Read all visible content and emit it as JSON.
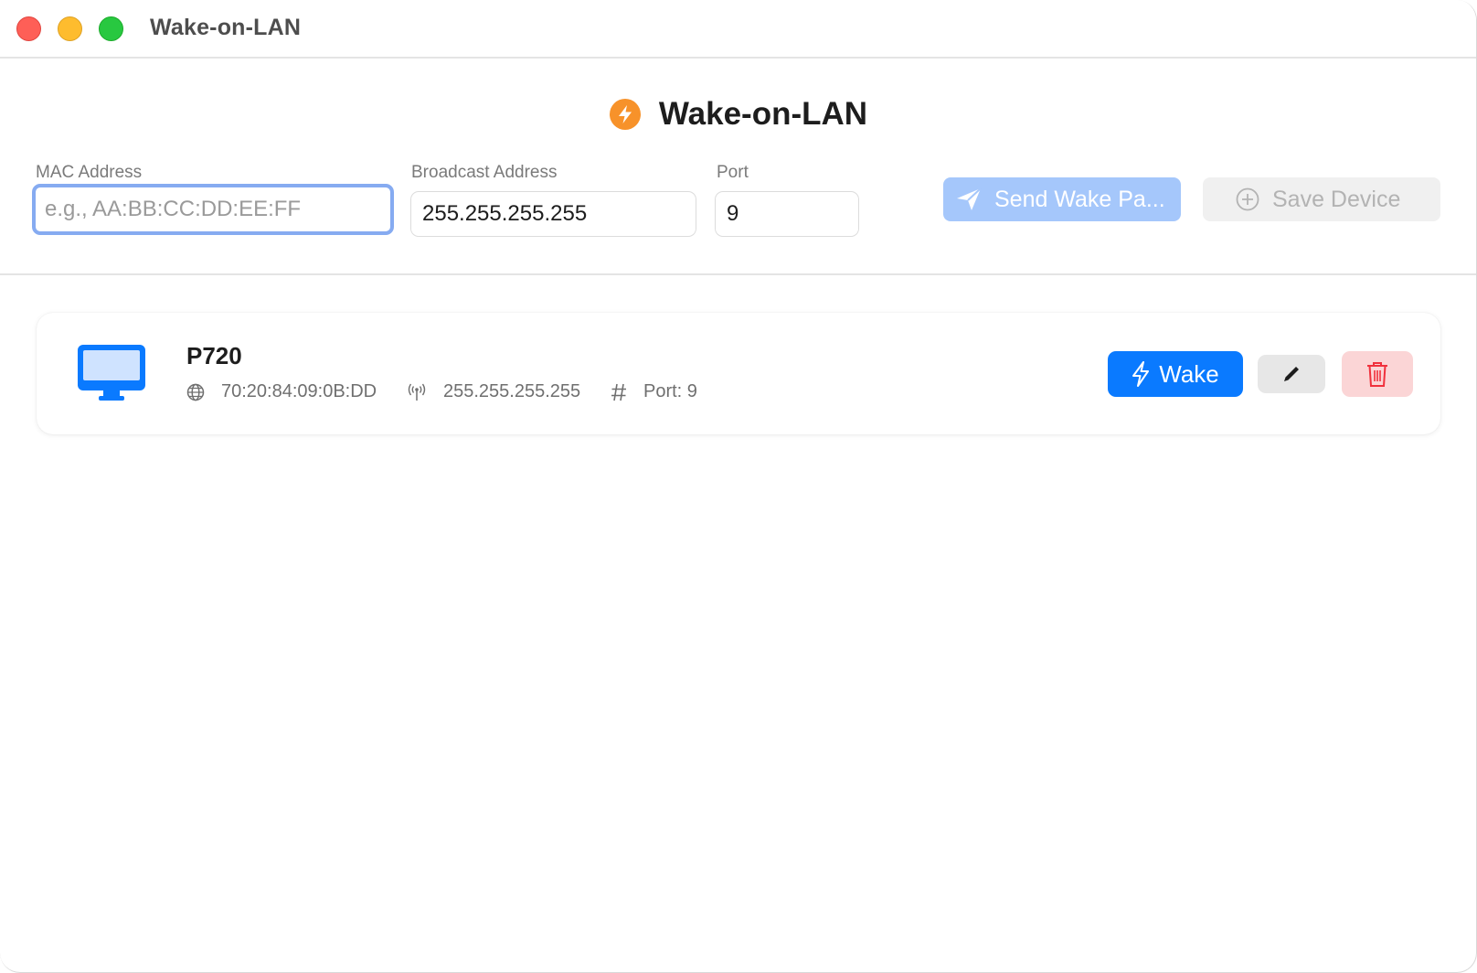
{
  "window": {
    "title": "Wake-on-LAN"
  },
  "header": {
    "title": "Wake-on-LAN",
    "icon": "bolt-icon",
    "icon_color": "#f7922a"
  },
  "form": {
    "mac": {
      "label": "MAC Address",
      "value": "",
      "placeholder": "e.g., AA:BB:CC:DD:EE:FF"
    },
    "broadcast": {
      "label": "Broadcast Address",
      "value": "255.255.255.255"
    },
    "port": {
      "label": "Port",
      "value": "9"
    },
    "send_label": "Send Wake Pa...",
    "save_label": "Save Device"
  },
  "devices": [
    {
      "name": "P720",
      "icon": "desktop-computer-icon",
      "mac": "70:20:84:09:0B:DD",
      "broadcast": "255.255.255.255",
      "port_text": "Port: 9",
      "wake_label": "Wake"
    }
  ],
  "colors": {
    "accent": "#0a7aff",
    "accent_disabled": "#a5c7fb",
    "danger_bg": "#fbd5d6",
    "danger": "#f0313d"
  }
}
